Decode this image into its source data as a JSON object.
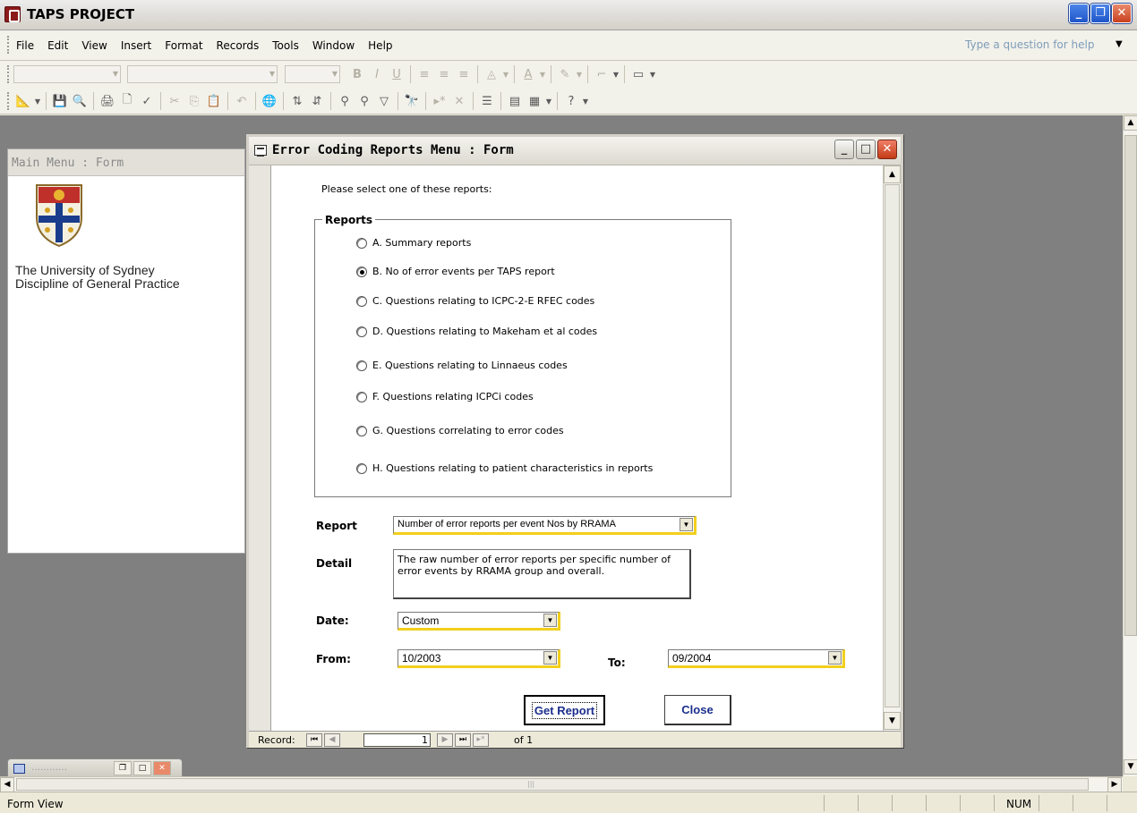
{
  "app": {
    "title": "TAPS PROJECT"
  },
  "menu": [
    "File",
    "Edit",
    "View",
    "Insert",
    "Format",
    "Records",
    "Tools",
    "Window",
    "Help"
  ],
  "help_box": {
    "placeholder": "Type a question for help"
  },
  "main_menu_form": {
    "title": "Main Menu : Form",
    "university_line1": "The University of Sydney",
    "university_line2": "Discipline of General Practice"
  },
  "error_form": {
    "title": "Error Coding Reports Menu : Form",
    "prompt": "Please select one of these reports:",
    "group_label": "Reports",
    "options": [
      {
        "label": "A. Summary reports",
        "selected": false
      },
      {
        "label": "B. No of error events per TAPS report",
        "selected": true
      },
      {
        "label": "C. Questions relating to ICPC-2-E RFEC codes",
        "selected": false
      },
      {
        "label": "D. Questions relating to Makeham et al codes",
        "selected": false
      },
      {
        "label": "E. Questions relating to Linnaeus codes",
        "selected": false
      },
      {
        "label": "F. Questions relating ICPCi  codes",
        "selected": false
      },
      {
        "label": "G. Questions correlating to error codes",
        "selected": false
      },
      {
        "label": "H. Questions relating to patient characteristics in reports",
        "selected": false
      }
    ],
    "report_label": "Report",
    "report_value": "Number of error reports per event Nos by RRAMA",
    "detail_label": "Detail",
    "detail_text": "The raw number of error reports per specific number of error events by RRAMA group and overall.",
    "date_label": "Date:",
    "date_value": "Custom",
    "from_label": "From:",
    "from_value": "10/2003",
    "to_label": "To:",
    "to_value": "09/2004",
    "get_report_label": "Get Report",
    "close_label": "Close",
    "record_nav": {
      "label": "Record:",
      "current": "1",
      "of_text": "of  1"
    }
  },
  "minimized_window": {
    "title": "…………"
  },
  "status": {
    "text": "Form View",
    "num": "NUM"
  },
  "colors": {
    "accent_yellow": "#f2cf1c",
    "button_text": "#1c2e8c",
    "mdi_background": "#808080"
  }
}
